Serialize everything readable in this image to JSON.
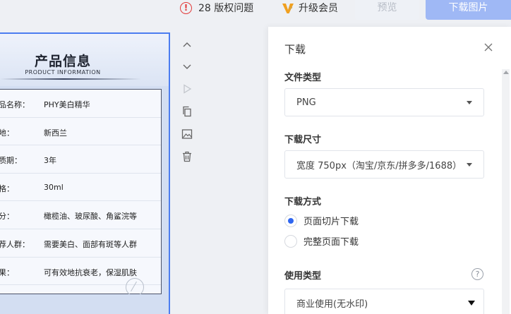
{
  "topbar": {
    "issues_text": "28 版权问题",
    "vip_label": "升级会员",
    "preview_label": "预览",
    "download_label": "下载图片"
  },
  "card": {
    "title": "产品信息",
    "subtitle": "PRODUCT INFORMATION",
    "rows": [
      {
        "key": "品名称：",
        "value": "PHY美白精华"
      },
      {
        "key": "地：",
        "value": "新西兰"
      },
      {
        "key": "质期：",
        "value": "3年"
      },
      {
        "key": "格：",
        "value": "30ml"
      },
      {
        "key": "分：",
        "value": "橄榄油、玻尿酸、角鲨浣等"
      },
      {
        "key": "荐人群：",
        "value": "需要美白、面部有斑等人群"
      },
      {
        "key": "果：",
        "value": "可有效地抗衰老，保湿肌肤"
      }
    ]
  },
  "tools": [
    "chevron-up-icon",
    "chevron-down-icon",
    "play-icon",
    "copy-icon",
    "image-icon",
    "trash-icon"
  ],
  "panel": {
    "title": "下载",
    "file_type_label": "文件类型",
    "file_type_value": "PNG",
    "size_label": "下载尺寸",
    "size_value": "宽度 750px（淘宝/京东/拼多多/1688）",
    "method_label": "下载方式",
    "method_options": [
      {
        "label": "页面切片下载",
        "selected": true
      },
      {
        "label": "完整页面下载",
        "selected": false
      }
    ],
    "usage_label": "使用类型",
    "usage_value": "商业使用(无水印)"
  },
  "colors": {
    "accent": "#2f66f0",
    "download_button": "#9fb8f5",
    "warning": "#e23a3a",
    "vip": "#f0a020"
  }
}
